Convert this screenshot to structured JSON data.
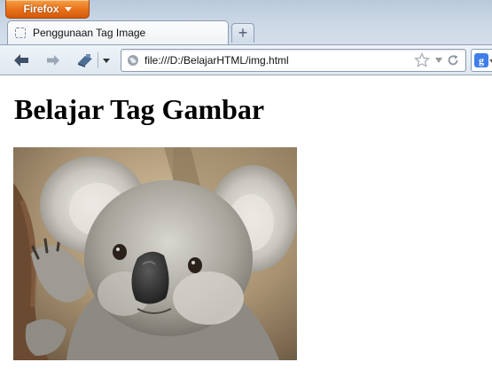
{
  "browser": {
    "menu_button_label": "Firefox",
    "tab": {
      "title": "Penggunaan Tag Image"
    },
    "new_tab_label": "+",
    "address_bar": {
      "url": "file:///D:/BelajarHTML/img.html"
    },
    "search_engine_icon": "google-icon",
    "icons": [
      "back-arrow-icon",
      "forward-arrow-icon",
      "bookmarks-icon",
      "globe-icon",
      "star-icon",
      "reload-icon",
      "chevron-down-icon"
    ]
  },
  "page": {
    "heading": "Belajar Tag Gambar",
    "image": {
      "subject": "koala"
    }
  },
  "colors": {
    "firefox_orange": "#e8701a",
    "chrome_blue": "#c9d6e4",
    "page_background": "#ffffff"
  }
}
